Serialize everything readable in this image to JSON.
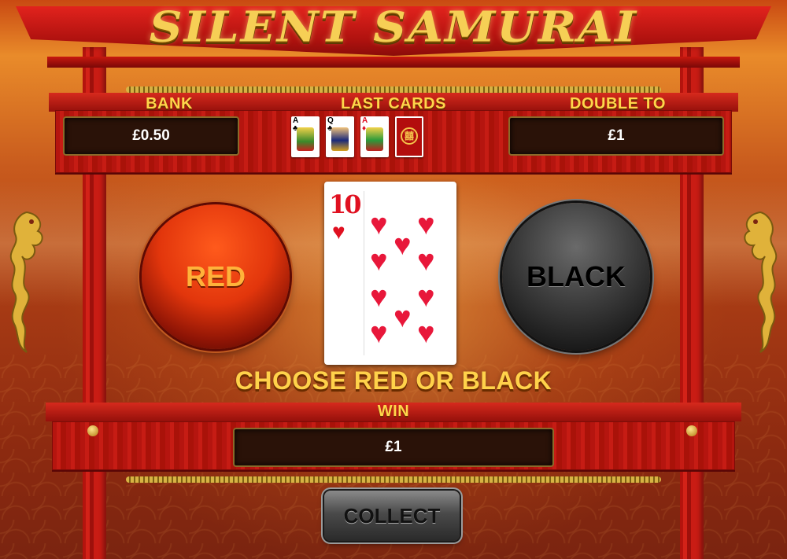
{
  "game": {
    "title": "SILENT SAMURAI"
  },
  "bank": {
    "label": "BANK",
    "value": "£0.50"
  },
  "last_cards": {
    "label": "LAST CARDS",
    "cards": [
      {
        "rank": "A",
        "suit": "♣",
        "color": "#000000"
      },
      {
        "rank": "Q",
        "suit": "♣",
        "color": "#000000"
      },
      {
        "rank": "A",
        "suit": "♦",
        "color": "#e01020"
      },
      {
        "rank": "",
        "suit": "back",
        "color": "#b30d0d"
      }
    ]
  },
  "double_to": {
    "label": "DOUBLE TO",
    "value": "£1"
  },
  "current_card": {
    "rank": "10",
    "suit": "♥",
    "color": "#e8173a"
  },
  "buttons": {
    "red": "RED",
    "black": "BLACK",
    "collect": "COLLECT"
  },
  "prompt": "CHOOSE RED OR BLACK",
  "win": {
    "label": "WIN",
    "value": "£1"
  },
  "colors": {
    "accent_gold": "#ffd64a",
    "gate_red": "#c61c14"
  }
}
